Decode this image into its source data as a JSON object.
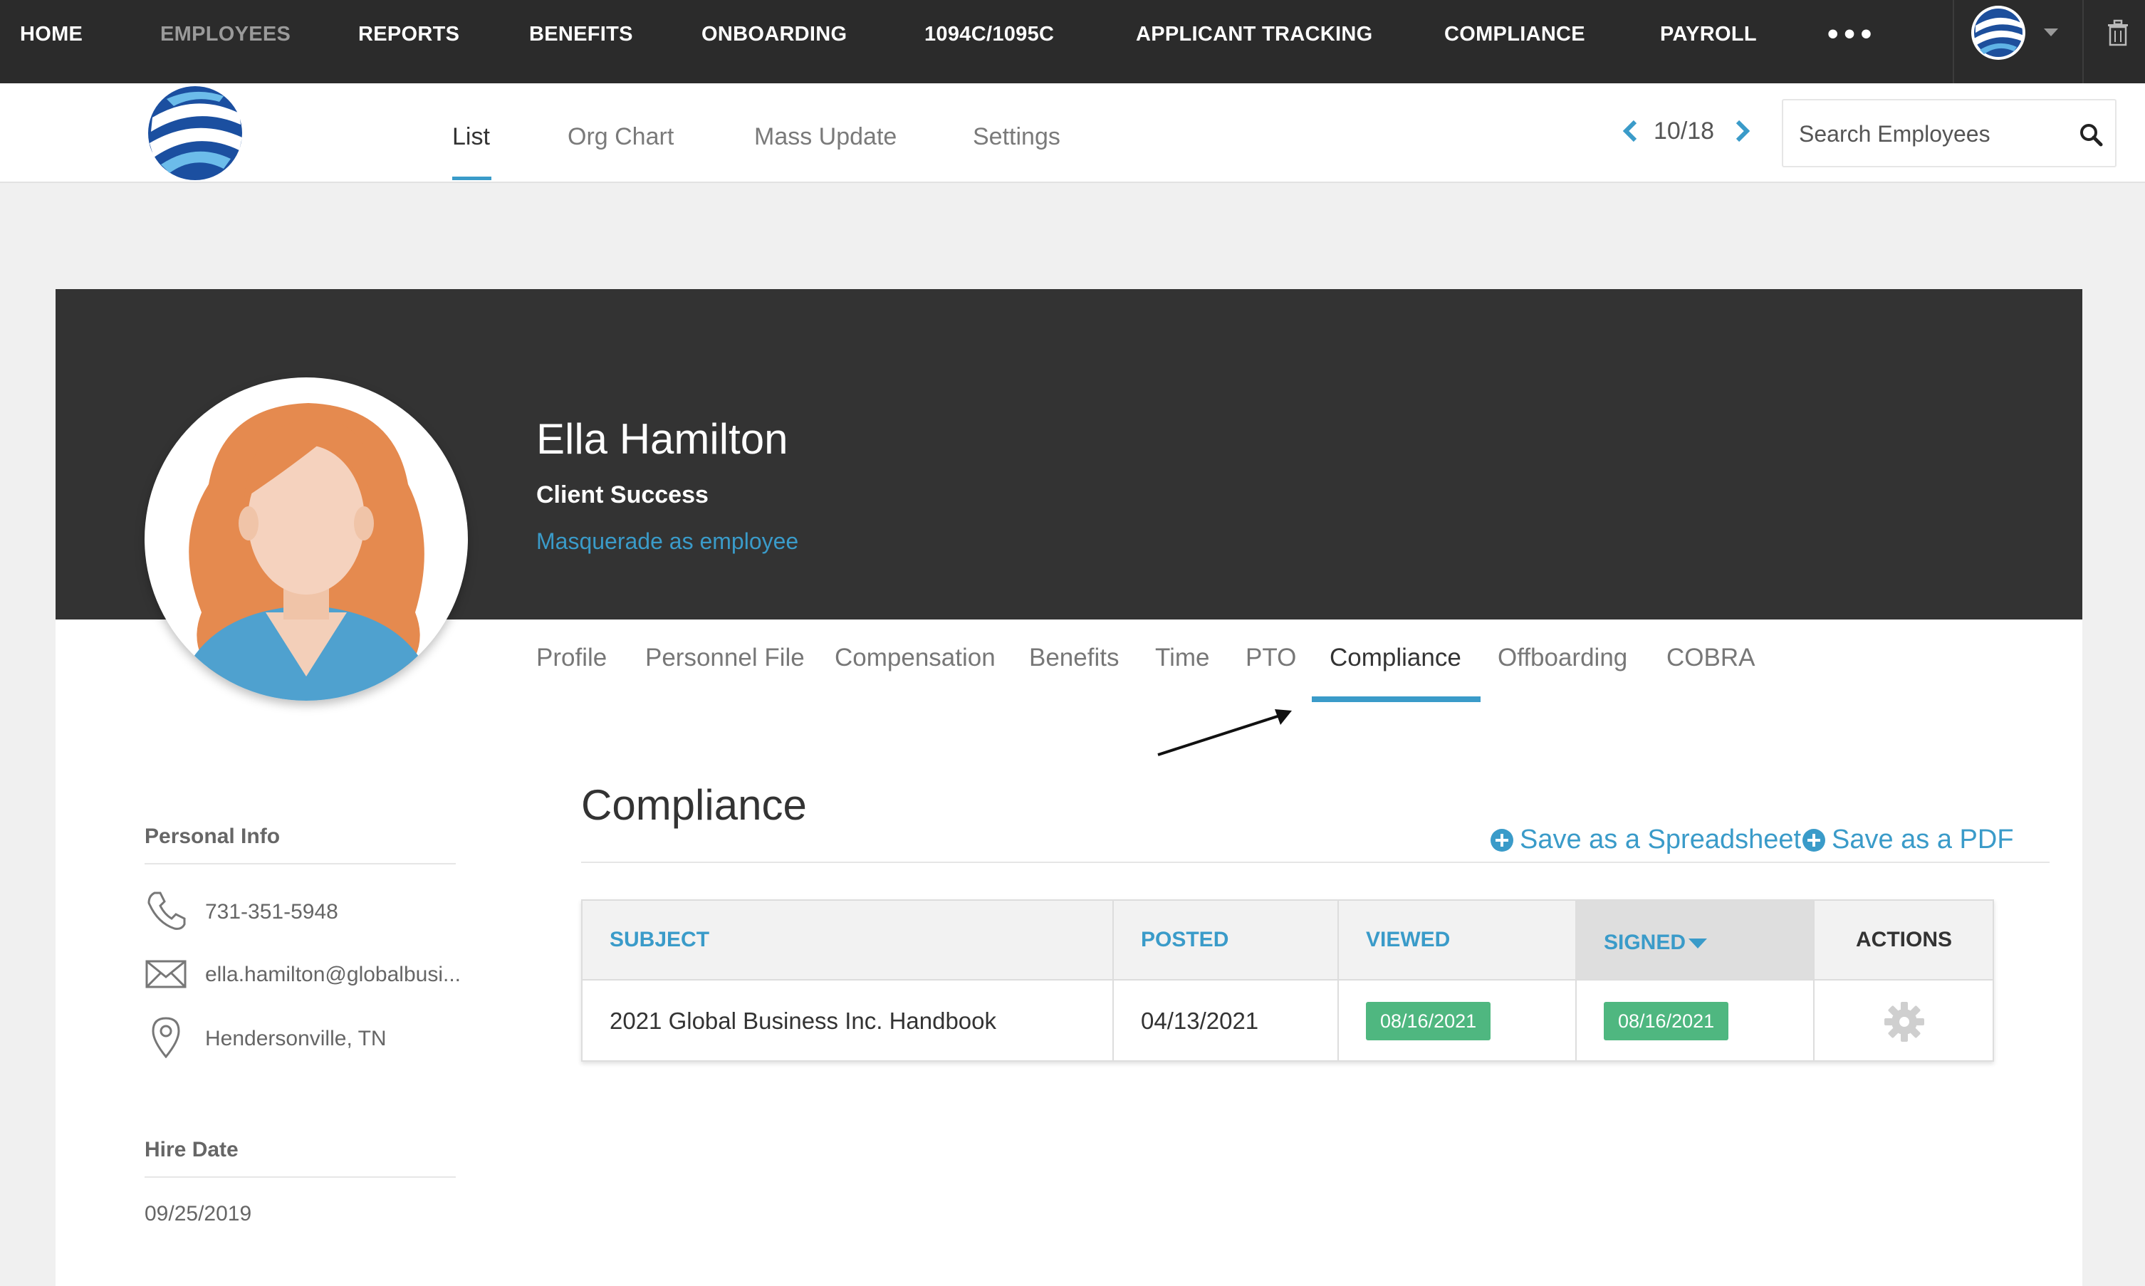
{
  "topnav": {
    "items": [
      {
        "label": "HOME",
        "active": false
      },
      {
        "label": "EMPLOYEES",
        "active": true
      },
      {
        "label": "REPORTS",
        "active": false
      },
      {
        "label": "BENEFITS",
        "active": false
      },
      {
        "label": "ONBOARDING",
        "active": false
      },
      {
        "label": "1094C/1095C",
        "active": false
      },
      {
        "label": "APPLICANT TRACKING",
        "active": false
      },
      {
        "label": "COMPLIANCE",
        "active": false
      },
      {
        "label": "PAYROLL",
        "active": false
      }
    ],
    "more_label": "•••"
  },
  "subheader": {
    "tabs": [
      {
        "label": "List",
        "active": true
      },
      {
        "label": "Org Chart",
        "active": false
      },
      {
        "label": "Mass Update",
        "active": false
      },
      {
        "label": "Settings",
        "active": false
      }
    ],
    "pager": "10/18",
    "search_placeholder": "Search Employees"
  },
  "employee": {
    "name": "Ella Hamilton",
    "department": "Client Success",
    "masquerade_label": "Masquerade as employee"
  },
  "profile_tabs": [
    {
      "label": "Profile",
      "active": false
    },
    {
      "label": "Personnel File",
      "active": false
    },
    {
      "label": "Compensation",
      "active": false
    },
    {
      "label": "Benefits",
      "active": false
    },
    {
      "label": "Time",
      "active": false
    },
    {
      "label": "PTO",
      "active": false
    },
    {
      "label": "Compliance",
      "active": true
    },
    {
      "label": "Offboarding",
      "active": false
    },
    {
      "label": "COBRA",
      "active": false
    }
  ],
  "sidebar": {
    "personal_info_heading": "Personal Info",
    "phone": "731-351-5948",
    "email": "ella.hamilton@globalbusi...",
    "location": "Hendersonville, TN",
    "hire_date_heading": "Hire Date",
    "hire_date": "09/25/2019"
  },
  "compliance": {
    "title": "Compliance",
    "save_spreadsheet": "Save as a Spreadsheet",
    "save_pdf": "Save as a PDF",
    "columns": [
      "SUBJECT",
      "POSTED",
      "VIEWED",
      "SIGNED",
      "ACTIONS"
    ],
    "sorted_column": "SIGNED",
    "rows": [
      {
        "subject": "2021 Global Business Inc. Handbook",
        "posted": "04/13/2021",
        "viewed": "08/16/2021",
        "signed": "08/16/2021"
      }
    ]
  },
  "colors": {
    "accent": "#3a9bc9",
    "nav_bg": "#2b2b2b",
    "hero_bg": "#333333",
    "badge_green": "#4fb780"
  },
  "icons": [
    "globe-logo-icon",
    "chevron-down-icon",
    "trash-icon",
    "chevron-left-icon",
    "chevron-right-icon",
    "search-icon",
    "phone-icon",
    "mail-icon",
    "location-pin-icon",
    "plus-circle-icon",
    "gear-icon",
    "arrow-icon"
  ]
}
